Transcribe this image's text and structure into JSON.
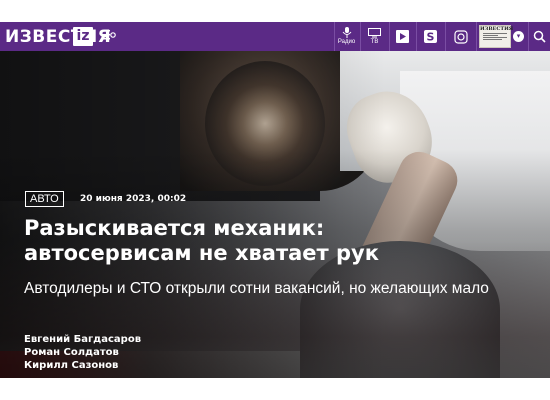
{
  "header": {
    "logo_text": "ИЗВЕСТИЯ",
    "logo_badge": "iz",
    "menu_icon": "hamburger-icon",
    "buttons": [
      {
        "name": "radio",
        "icon": "microphone-icon",
        "label": "Радио"
      },
      {
        "name": "tv",
        "icon": "tv-icon",
        "label": "ТВ"
      },
      {
        "name": "stories",
        "icon": "bookmark-icon",
        "label": ""
      },
      {
        "name": "app",
        "icon": "app-s-icon",
        "label": ""
      },
      {
        "name": "theme",
        "icon": "settings-icon",
        "label": ""
      }
    ],
    "newspaper_title": "ИЗВЕСТИЯ",
    "search_icon": "search-icon",
    "brand_color": "#5b2a86"
  },
  "article": {
    "rubric": "Авто",
    "date": "20 июня 2023, 00:02",
    "title_line1": "Разыскивается механик:",
    "title_line2": "автосервисам не хватает рук",
    "lead": "Автодилеры и СТО открыли сотни вакансий, но желающих мало",
    "authors": [
      "Евгений Багдасаров",
      "Роман Солдатов",
      "Кирилл Сазонов"
    ]
  }
}
